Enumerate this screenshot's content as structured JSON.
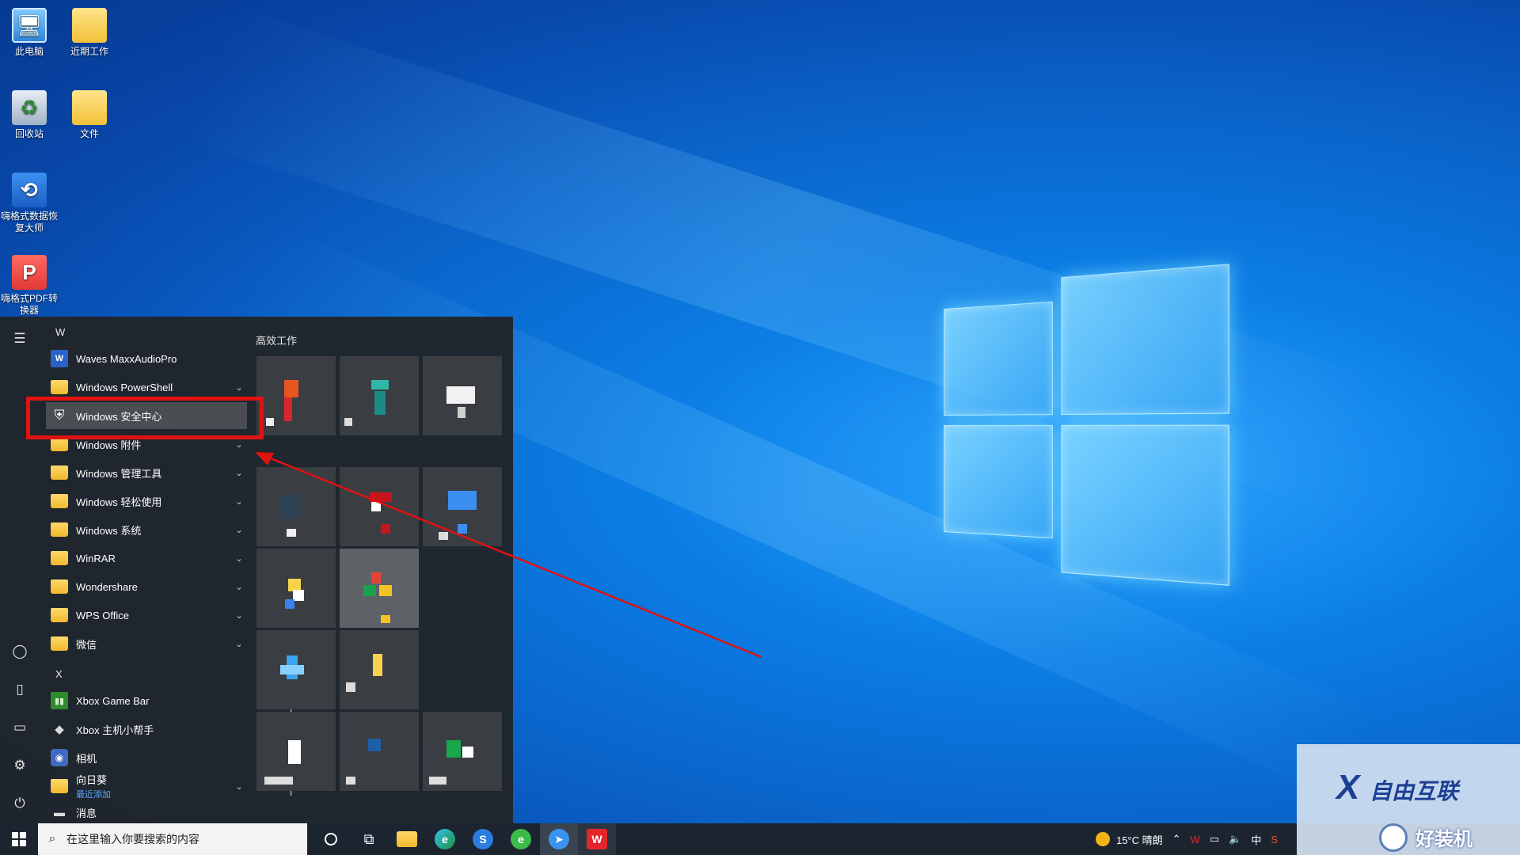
{
  "desktop": {
    "icons": [
      {
        "label": "此电脑",
        "icon": "pc-icon"
      },
      {
        "label": "近期工作",
        "icon": "folder-icon"
      },
      {
        "label": "回收站",
        "icon": "recycle-bin-icon"
      },
      {
        "label": "文件",
        "icon": "folder-icon"
      },
      {
        "label": "嗨格式数据恢复大师",
        "icon": "data-recovery-icon"
      },
      {
        "label": "嗨格式PDF转换器",
        "icon": "pdf-converter-icon"
      }
    ]
  },
  "start_menu": {
    "sections": {
      "w": "W",
      "x": "X"
    },
    "apps": [
      {
        "label": "Waves MaxxAudioPro",
        "icon": "waves-icon",
        "expandable": false
      },
      {
        "label": "Windows PowerShell",
        "icon": "folder-icon",
        "expandable": true
      },
      {
        "label": "Windows 安全中心",
        "icon": "shield-icon",
        "expandable": false,
        "selected": true
      },
      {
        "label": "Windows 附件",
        "icon": "folder-icon",
        "expandable": true
      },
      {
        "label": "Windows 管理工具",
        "icon": "folder-icon",
        "expandable": true
      },
      {
        "label": "Windows 轻松使用",
        "icon": "folder-icon",
        "expandable": true
      },
      {
        "label": "Windows 系统",
        "icon": "folder-icon",
        "expandable": true
      },
      {
        "label": "WinRAR",
        "icon": "folder-icon",
        "expandable": true
      },
      {
        "label": "Wondershare",
        "icon": "folder-icon",
        "expandable": true
      },
      {
        "label": "WPS Office",
        "icon": "folder-icon",
        "expandable": true
      },
      {
        "label": "微信",
        "icon": "folder-icon",
        "expandable": true
      },
      {
        "label": "Xbox Game Bar",
        "icon": "xbox-icon",
        "expandable": false
      },
      {
        "label": "Xbox 主机小帮手",
        "icon": "xbox-companion-icon",
        "expandable": false
      },
      {
        "label": "相机",
        "icon": "camera-icon",
        "expandable": false
      },
      {
        "label": "向日葵",
        "sublabel": "最近添加",
        "icon": "folder-icon",
        "expandable": true
      },
      {
        "label": "消息",
        "icon": "message-icon",
        "expandable": false
      }
    ],
    "tiles_group_title": "高效工作"
  },
  "taskbar": {
    "search_placeholder": "在这里输入你要搜索的内容",
    "weather": "15°C 晴朗",
    "ime": "中"
  },
  "watermark": {
    "brand": "自由互联",
    "site": "好装机"
  },
  "colors": {
    "highlight": "#e01212",
    "desktop_accent": "#0b7fe6",
    "start_bg": "#202429"
  }
}
